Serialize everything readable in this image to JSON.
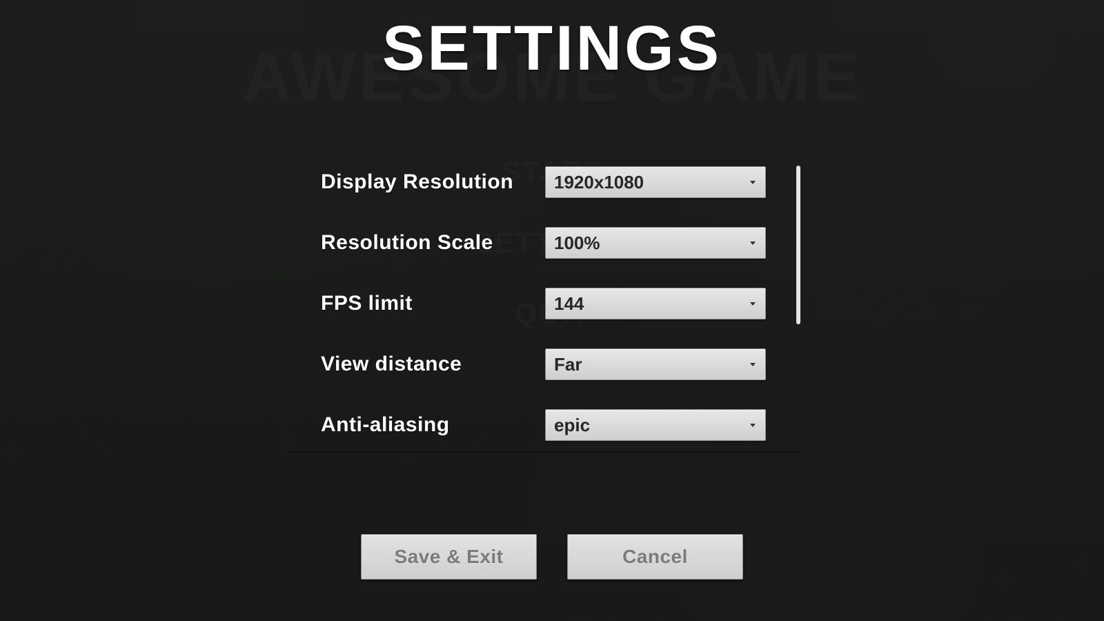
{
  "background_menu": {
    "title": "AWESOME GAME",
    "items": [
      "START",
      "SETTINGS",
      "QUIT"
    ]
  },
  "settings": {
    "title": "SETTINGS",
    "rows": [
      {
        "label": "Display Resolution",
        "value": "1920x1080"
      },
      {
        "label": "Resolution Scale",
        "value": "100%"
      },
      {
        "label": "FPS limit",
        "value": "144"
      },
      {
        "label": "View distance",
        "value": "Far"
      },
      {
        "label": "Anti-aliasing",
        "value": "epic"
      }
    ]
  },
  "buttons": {
    "save": "Save & Exit",
    "cancel": "Cancel"
  }
}
